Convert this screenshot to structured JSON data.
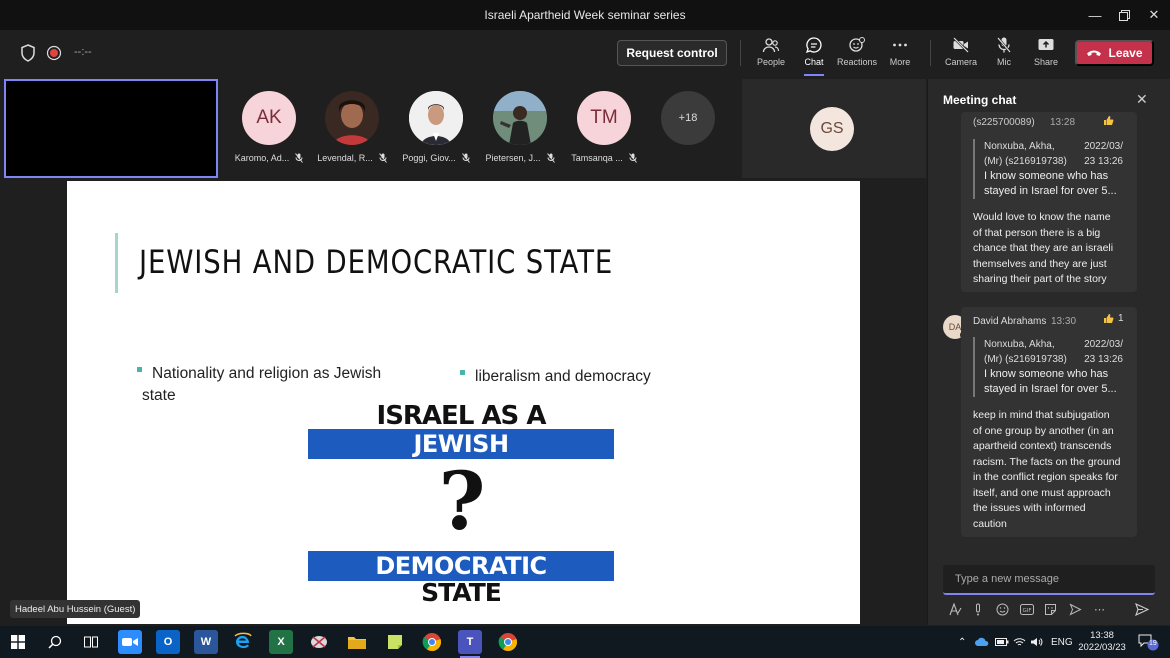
{
  "window": {
    "title": "Israeli Apartheid Week seminar series"
  },
  "toolbar": {
    "timer": "--:--",
    "request_control": "Request control",
    "people": "People",
    "chat": "Chat",
    "reactions": "Reactions",
    "more": "More",
    "camera": "Camera",
    "mic": "Mic",
    "share": "Share",
    "leave": "Leave"
  },
  "participants": [
    {
      "initials": "AK",
      "name": "Karomo, Ad...",
      "photo": false
    },
    {
      "initials": "",
      "name": "Levendal, R...",
      "photo": true
    },
    {
      "initials": "",
      "name": "Poggi, Giov...",
      "photo": true
    },
    {
      "initials": "",
      "name": "Pietersen, J...",
      "photo": true
    },
    {
      "initials": "TM",
      "name": "Tamsanqa ...",
      "photo": false
    }
  ],
  "more_participants": "+18",
  "spotlight_initials": "GS",
  "slide": {
    "title": "JEWISH AND DEMOCRATIC STATE",
    "bullet_1_line_1": "Nationality and religion as Jewish",
    "bullet_1_line_2": "state",
    "bullet_2": "liberalism and democracy",
    "graphic_line_1": "ISRAEL AS A",
    "graphic_line_2": "JEWISH",
    "graphic_line_3": "?",
    "graphic_line_4": "DEMOCRATIC",
    "graphic_line_5": "STATE"
  },
  "presenter_tag": "Hadeel Abu Hussein (Guest)",
  "chat": {
    "title": "Meeting chat",
    "partial_header_id": "(s225700089)",
    "partial_header_time": "13:28",
    "msg1_quote": {
      "author_line_1": "Nonxuba, Akha,",
      "author_line_2": "(Mr) (s216919738)",
      "date_line_1": "2022/03/",
      "date_line_2": "23 13:26",
      "text_line_1": "I know someone who has",
      "text_line_2": "stayed in Israel for over 5..."
    },
    "msg1_lines": [
      "Would love to know the name",
      "of that person there is a big",
      "chance that they are an israeli",
      "themselves and they are just",
      "sharing their part of the story"
    ],
    "msg2_avatar": "DA",
    "msg2_author": "David Abrahams",
    "msg2_time": "13:30",
    "msg2_reaction_count": "1",
    "msg2_quote": {
      "author_line_1": "Nonxuba, Akha,",
      "author_line_2": "(Mr) (s216919738)",
      "date_line_1": "2022/03/",
      "date_line_2": "23 13:26",
      "text_line_1": "I know someone who has",
      "text_line_2": "stayed in Israel for over 5..."
    },
    "msg2_lines": [
      "keep in mind that subjugation",
      "of one group by another (in an",
      "apartheid context) transcends",
      "racism. The facts on the ground",
      "in the conflict region speaks for",
      "itself, and one must approach",
      "the issues with informed",
      "caution"
    ],
    "compose_placeholder": "Type a new message"
  },
  "taskbar": {
    "language": "ENG",
    "time": "13:38",
    "date": "2022/03/23",
    "notification_count": "19"
  },
  "colors": {
    "accent": "#7f85f5",
    "leave": "#c4314b",
    "slide_band": "#1e5bbf",
    "slide_accent": "#4ab3ac"
  }
}
